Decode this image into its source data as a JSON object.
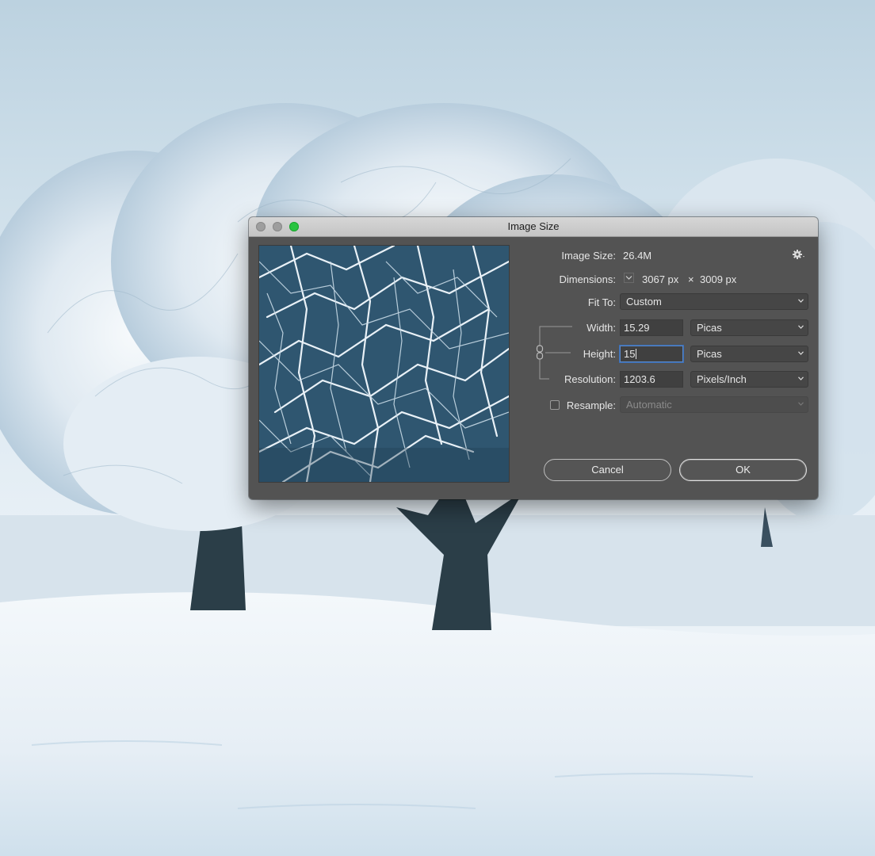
{
  "dialog": {
    "title": "Image Size",
    "image_size": {
      "label": "Image Size:",
      "value": "26.4M"
    },
    "dimensions": {
      "label": "Dimensions:",
      "width": "3067 px",
      "separator": "×",
      "height": "3009 px"
    },
    "fit_to": {
      "label": "Fit To:",
      "selected": "Custom"
    },
    "width": {
      "label": "Width:",
      "value": "15.29",
      "unit": "Picas"
    },
    "height": {
      "label": "Height:",
      "value": "15",
      "unit": "Picas"
    },
    "resolution": {
      "label": "Resolution:",
      "value": "1203.6",
      "unit": "Pixels/Inch"
    },
    "resample": {
      "label": "Resample:",
      "checked": false,
      "method": "Automatic"
    },
    "buttons": {
      "cancel": "Cancel",
      "ok": "OK"
    },
    "icons": {
      "settings": "gear-icon",
      "dimensions_menu": "chevron-down-icon",
      "constrain": "chain-link-icon"
    }
  },
  "colors": {
    "dialog_bg": "#535353",
    "zoom_button": "#29c440",
    "focus_ring": "#3a6eb6"
  }
}
